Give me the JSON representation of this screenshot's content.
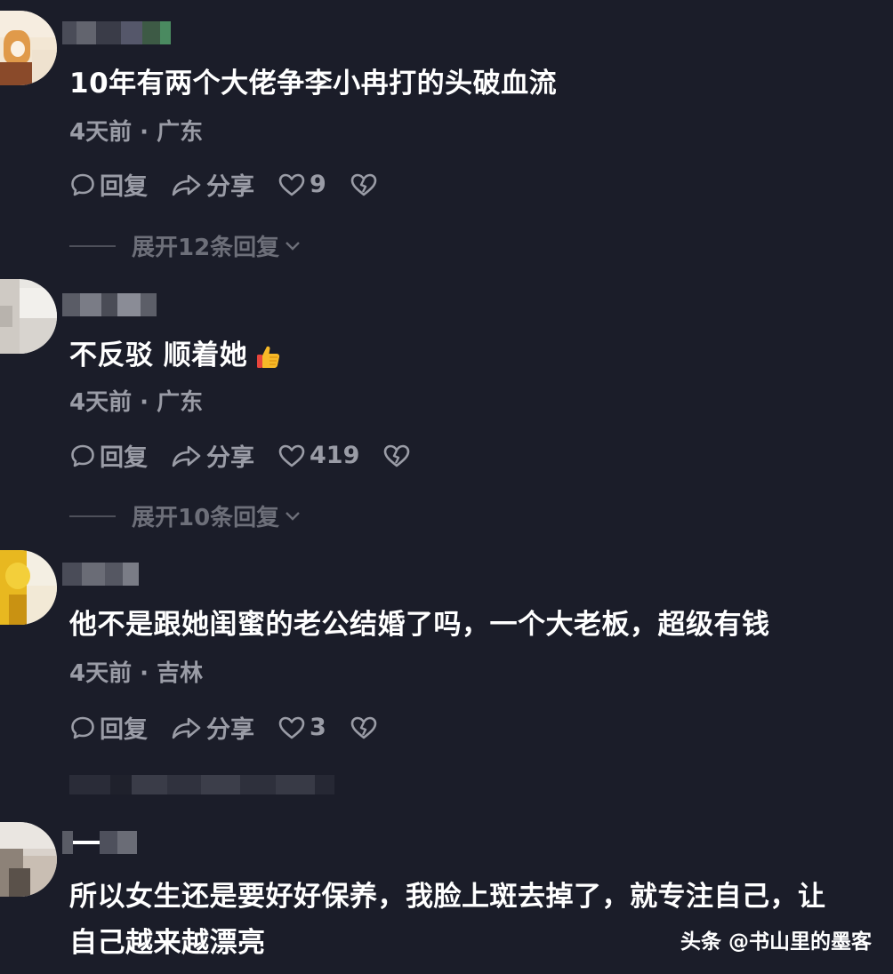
{
  "comments": [
    {
      "text": "10年有两个大佬争李小冉打的头破血流",
      "meta": "4天前 · 广东",
      "reply_label": "回复",
      "share_label": "分享",
      "likes": "9",
      "expand_label": "展开12条回复"
    },
    {
      "text": "不反驳 顺着她",
      "meta": "4天前 · 广东",
      "reply_label": "回复",
      "share_label": "分享",
      "likes": "419",
      "expand_label": "展开10条回复"
    },
    {
      "text": "他不是跟她闺蜜的老公结婚了吗，一个大老板，超级有钱",
      "meta": "4天前 · 吉林",
      "reply_label": "回复",
      "share_label": "分享",
      "likes": "3"
    },
    {
      "text_line1": "所以女生还是要好好保养，我脸上斑去掉了，就专注自己，让",
      "text_line2": "自己越来越漂亮"
    }
  ],
  "watermark": "头条 @书山里的墨客",
  "icons": {
    "reply": "comment-bubble-icon",
    "share": "share-arrow-icon",
    "like": "heart-icon",
    "dislike": "broken-heart-icon",
    "expand": "chevron-down-icon",
    "emoji": "thumbs-up-emoji"
  },
  "colors": {
    "background": "#1b1d29",
    "text": "#ffffff",
    "secondary": "#9a9ca6",
    "muted": "#6d6f79"
  }
}
